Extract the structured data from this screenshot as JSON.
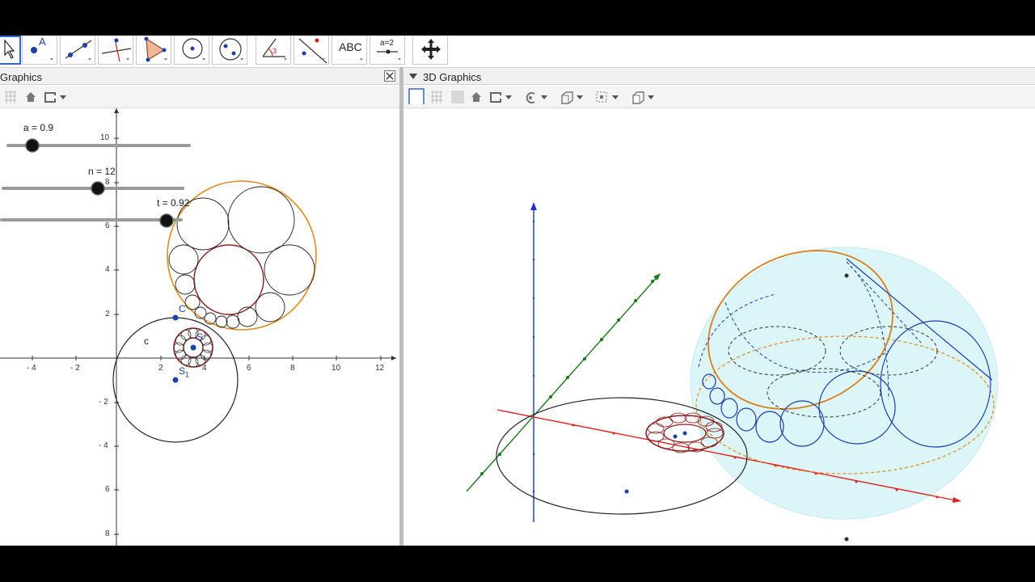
{
  "toolbar": {
    "tools": [
      {
        "name": "move-tool",
        "glyph": "↖"
      },
      {
        "name": "point-tool",
        "glyph": "A"
      },
      {
        "name": "line-tool",
        "glyph": ""
      },
      {
        "name": "perpendicular-tool",
        "glyph": ""
      },
      {
        "name": "polygon-tool",
        "glyph": ""
      },
      {
        "name": "circle-tool",
        "glyph": ""
      },
      {
        "name": "ellipse-tool",
        "glyph": ""
      },
      {
        "name": "angle-tool",
        "glyph": "3"
      },
      {
        "name": "reflect-tool",
        "glyph": ""
      },
      {
        "name": "text-tool",
        "glyph": "ABC"
      },
      {
        "name": "slider-tool",
        "glyph": "a=2"
      },
      {
        "name": "move-view-tool",
        "glyph": "✥"
      }
    ]
  },
  "graphics2d": {
    "title": "Graphics",
    "sliders": {
      "a": "a = 0.9",
      "n": "n = 12",
      "t": "t = 0.92"
    },
    "slider_values": {
      "a": 0.9,
      "n": 12,
      "t": 0.92
    },
    "point_labels": {
      "c_point": "C",
      "circle_c": "c",
      "s_point": "S",
      "s1_point": "S",
      "s1_sub": "1"
    },
    "x_ticks": [
      "- 4",
      "- 2",
      "2",
      "4",
      "6",
      "8",
      "10",
      "12"
    ],
    "y_ticks": [
      "10",
      "8",
      "6",
      "4",
      "2",
      "- 2",
      "- 4",
      "6",
      "8"
    ]
  },
  "graphics3d": {
    "title": "3D Graphics"
  },
  "colors": {
    "accent": "#3864c8",
    "orange": "#e08a1e",
    "darkred": "#8b1a1a",
    "blue": "#1c3fa8",
    "sphere": "#d6f3f8",
    "x_axis": "#e02020",
    "y_axis": "#1a7a1a",
    "z_axis": "#2035c8"
  }
}
